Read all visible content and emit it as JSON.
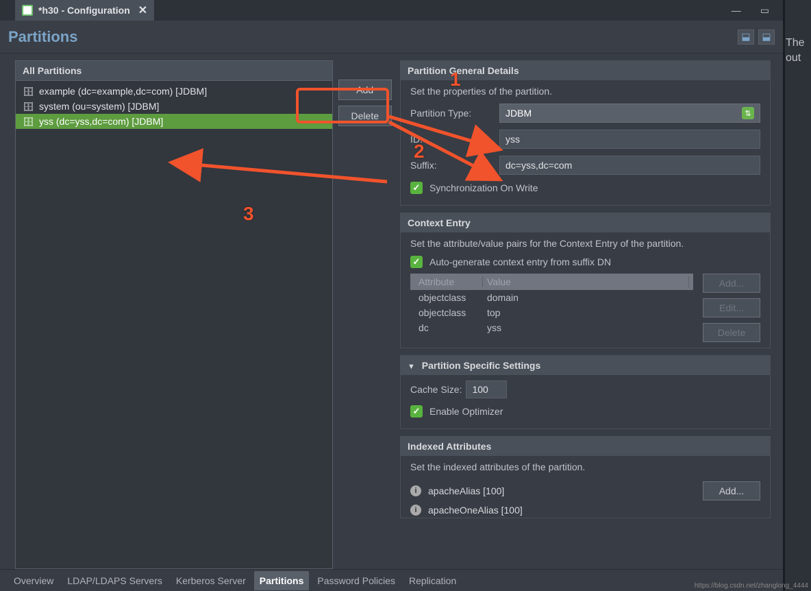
{
  "tab": {
    "title": "*h30 - Configuration"
  },
  "header": {
    "title": "Partitions"
  },
  "allPartitions": {
    "title": "All Partitions",
    "items": [
      {
        "label": "example (dc=example,dc=com) [JDBM]"
      },
      {
        "label": "system (ou=system) [JDBM]"
      },
      {
        "label": "yss (dc=yss,dc=com) [JDBM]"
      }
    ],
    "addBtn": "Add",
    "deleteBtn": "Delete"
  },
  "general": {
    "title": "Partition General Details",
    "desc": "Set the properties of the partition.",
    "typeLabel": "Partition Type:",
    "typeValue": "JDBM",
    "idLabel": "ID:",
    "idValue": "yss",
    "suffixLabel": "Suffix:",
    "suffixValue": "dc=yss,dc=com",
    "syncLabel": "Synchronization On Write"
  },
  "context": {
    "title": "Context Entry",
    "desc": "Set the attribute/value pairs for the Context Entry of the partition.",
    "autoLabel": "Auto-generate context entry from suffix DN",
    "thAttr": "Attribute",
    "thVal": "Value",
    "rows": [
      {
        "attr": "objectclass",
        "val": "domain"
      },
      {
        "attr": "objectclass",
        "val": "top"
      },
      {
        "attr": "dc",
        "val": "yss"
      }
    ],
    "addBtn": "Add...",
    "editBtn": "Edit...",
    "deleteBtn": "Delete"
  },
  "specific": {
    "title": "Partition Specific Settings",
    "cacheLabel": "Cache Size:",
    "cacheValue": "100",
    "optLabel": "Enable Optimizer"
  },
  "indexed": {
    "title": "Indexed Attributes",
    "desc": "Set the indexed attributes of the partition.",
    "items": [
      {
        "label": "apacheAlias [100]"
      },
      {
        "label": "apacheOneAlias [100]"
      }
    ],
    "addBtn": "Add..."
  },
  "bottomTabs": [
    "Overview",
    "LDAP/LDAPS Servers",
    "Kerberos Server",
    "Partitions",
    "Password Policies",
    "Replication"
  ],
  "rightStrip": {
    "line1": "The",
    "line2": "out"
  },
  "annotations": {
    "n1": "1",
    "n2": "2",
    "n3": "3"
  },
  "watermark": "https://blog.csdn.net/zhanglong_4444"
}
